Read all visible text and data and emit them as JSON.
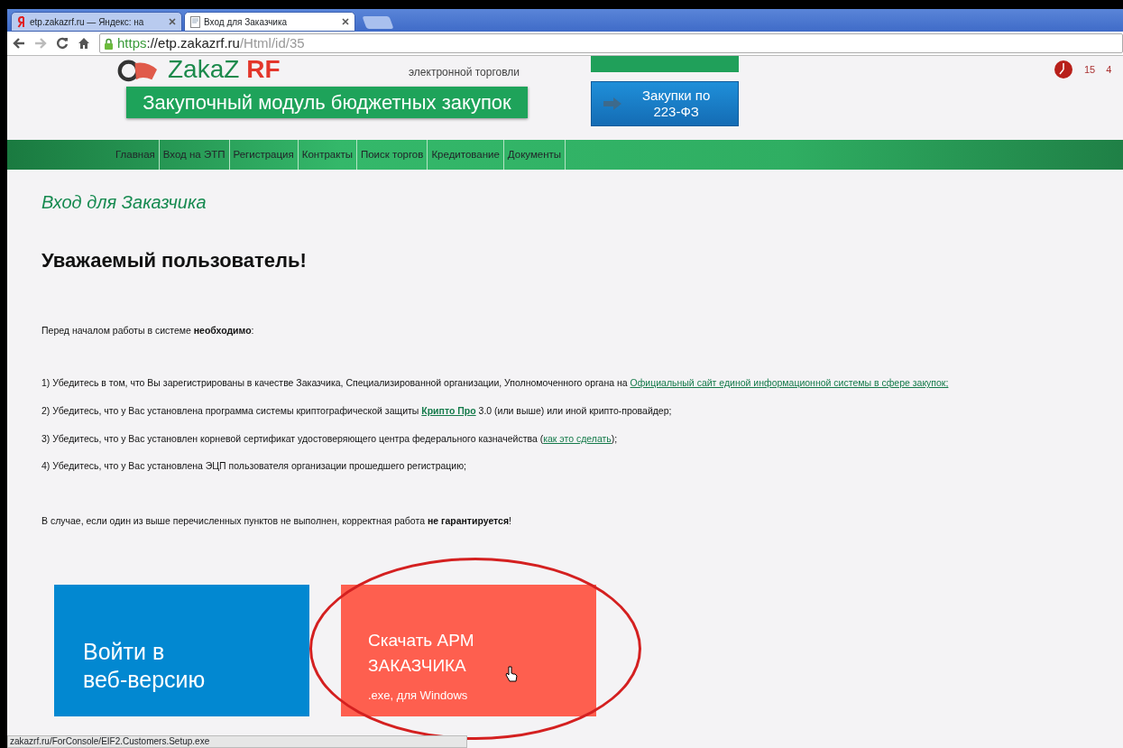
{
  "browser": {
    "tabs": [
      {
        "label": "etp.zakazrf.ru — Яндекс: на",
        "selected": false,
        "kind": "yandex"
      },
      {
        "label": "Вход для Заказчика",
        "selected": true,
        "kind": "page"
      }
    ],
    "url": {
      "scheme": "https",
      "host": "://etp.zakazrf.ru",
      "path": "/Html/id/35"
    }
  },
  "header": {
    "logo": [
      "ZakaZ",
      "RF"
    ],
    "logo_caption": "электронной торговли",
    "banner": "Закупочный модуль бюджетных закупок",
    "side_button": [
      "Закупки по",
      "223-ФЗ"
    ],
    "clock": [
      "15",
      "4"
    ]
  },
  "nav": [
    "Главная",
    "Вход на ЭТП",
    "Регистрация",
    "Контракты",
    "Поиск торгов",
    "Кредитование",
    "Документы"
  ],
  "content": {
    "title": "Вход для Заказчика",
    "heading": "Уважаемый пользователь!",
    "intro": "Перед началом работы в системе **необходимо**:",
    "requirements": [
      {
        "before": "1) Убедитесь в том, что Вы зарегистрированы в качестве Заказчика, Специализированной организации, Уполномоченного органа на ",
        "link": {
          "text": "Официальный сайт единой информационной системы в сфере закупок;",
          "bold": false
        }
      },
      {
        "before": "2) Убедитесь, что у Вас установлена программа системы криптографической защиты ",
        "link": {
          "text": "Крипто Про",
          "bold": true
        },
        "after": " 3.0 (или выше) или иной крипто-провайдер;"
      },
      {
        "before": "3) Убедитесь, что у Вас установлен корневой сертификат удостоверяющего центра федерального казначейства (",
        "link": {
          "text": "как это сделать",
          "bold": false
        },
        "after": ");"
      },
      {
        "before": "4) Убедитесь, что у Вас установлена ЭЦП пользователя организации прошедшего регистрацию;"
      }
    ],
    "warning": "В случае, если один из выше перечисленных пунктов не выполнен, корректная работа **не гарантируется**!"
  },
  "tiles": [
    {
      "kind": "web",
      "color": "#0288d1",
      "lines": [
        "Войти в",
        "веб-версию"
      ]
    },
    {
      "kind": "download",
      "color": "#fe5f4f",
      "lines": [
        "Скачать АРМ",
        "ЗАКАЗЧИКА"
      ],
      "subtitle": ".exe, для Windows"
    }
  ],
  "status_bar": "zakazrf.ru/ForConsole/EIF2.Customers.Setup.exe"
}
